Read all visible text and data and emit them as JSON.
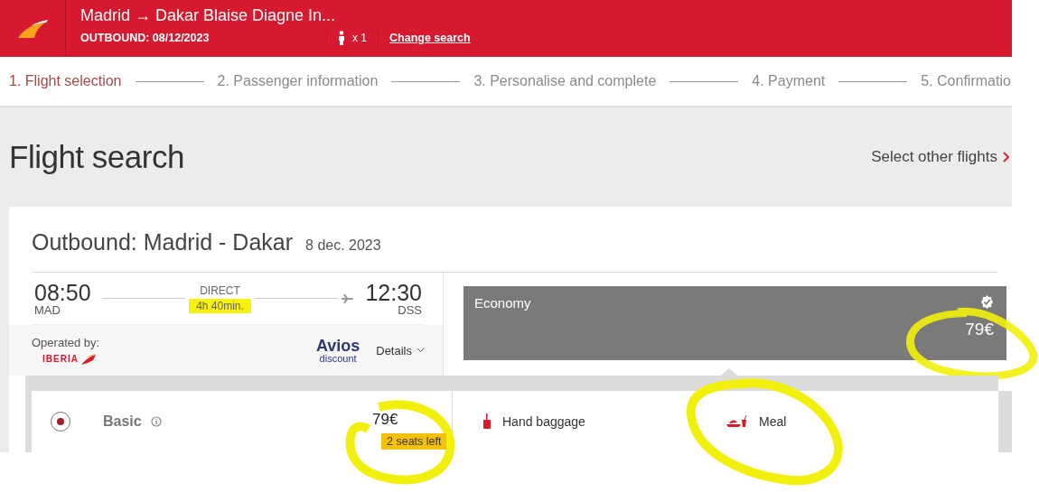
{
  "header": {
    "route": "Madrid → Dakar Blaise Diagne In...",
    "outbound": "OUTBOUND: 08/12/2023",
    "passengers": "x 1",
    "change_search": "Change search"
  },
  "steps": [
    {
      "label": "1. Flight selection",
      "selected": true
    },
    {
      "label": "2. Passenger information",
      "selected": false
    },
    {
      "label": "3. Personalise and complete",
      "selected": false
    },
    {
      "label": "4. Payment",
      "selected": false
    },
    {
      "label": "5. Confirmatio",
      "selected": false
    }
  ],
  "page_title": "Flight search",
  "select_other": "Select other flights",
  "outbound": {
    "title": "Outbound: Madrid - Dakar",
    "date": "8 dec. 2023",
    "departure_time": "08:50",
    "departure_airport": "MAD",
    "stops": "DIRECT",
    "duration": "4h 40min.",
    "duration_marked": true,
    "arrival_time": "12:30",
    "arrival_airport": "DSS",
    "operated_by": "Operated by:",
    "airline": "IBERIA",
    "avios": "Avios",
    "avios_sub": "discount",
    "details": "Details"
  },
  "cabin": {
    "name": "Economy",
    "price": "79€",
    "selected": true,
    "marked": true
  },
  "fares": [
    {
      "name": "Basic",
      "price": "79€",
      "seats": "2 seats left",
      "selected": true,
      "price_marked": true,
      "benefits": [
        {
          "kind": "baggage",
          "label": "Hand baggage",
          "marked": false
        },
        {
          "kind": "meal",
          "label": "Meal",
          "marked": true
        }
      ]
    }
  ]
}
